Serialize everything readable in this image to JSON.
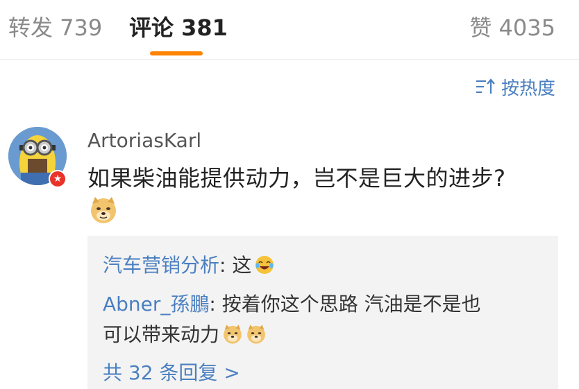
{
  "tabs": {
    "repost": "转发 739",
    "comment": "评论 381",
    "like": "赞 4035"
  },
  "sort": {
    "label": "按热度",
    "icon": "sort-icon"
  },
  "comment": {
    "username": "ArtoriasKarl",
    "text": "如果柴油能提供动力，岂不是巨大的进步?",
    "emoji": "doge-emoji",
    "badge_icon": "vip-star-icon"
  },
  "replies": [
    {
      "author": "汽车营销分析",
      "separator": ": ",
      "text": "这",
      "emoji": "laugh-cry-emoji"
    },
    {
      "author": "Abner_孫鵬",
      "separator": ": ",
      "text": "按着你这个思路 汽油是不是也",
      "text_cont": "可以带来动力",
      "emoji": "doge-emoji"
    }
  ],
  "more_replies": "共 32 条回复 >",
  "colors": {
    "accent": "#ff8200",
    "link": "#4a7fc0",
    "reply_bg": "#f3f3f3",
    "badge": "#e8322a"
  }
}
